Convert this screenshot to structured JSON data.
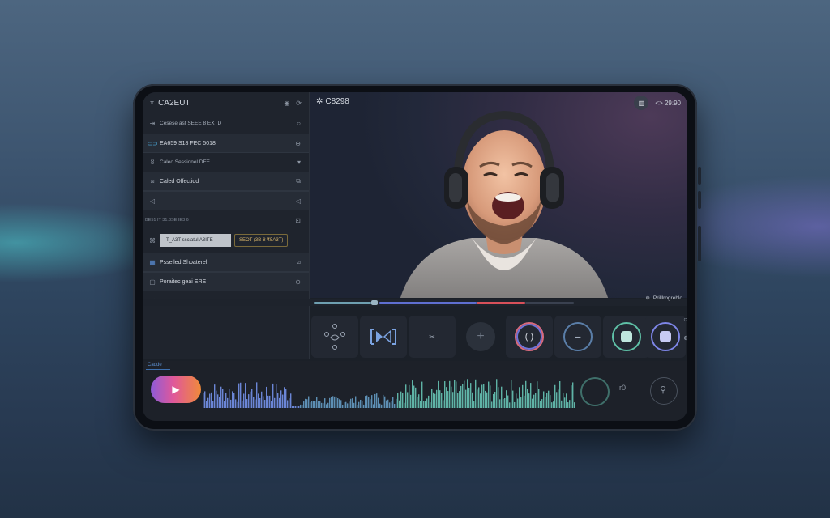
{
  "sidebar": {
    "title": "CA2EUT",
    "items": [
      {
        "label": "Cesese ast SEEE 8 EXTD",
        "type": "plain"
      },
      {
        "label": "EA659 S18 FEC 5018",
        "type": "boxed"
      },
      {
        "label": "Caleo Sessionel DEF",
        "type": "plain"
      },
      {
        "label": "Caled Offectiod",
        "type": "boxed"
      },
      {
        "label": "",
        "type": "boxed"
      },
      {
        "label": "BE51 IT 31.3SE IE3 6",
        "type": "plain"
      },
      {
        "label": "T_A3T ssciatul A3ITE",
        "type": "pill"
      },
      {
        "label": "SEOT (3B-8 ₹5A3T)",
        "type": "pill-gold"
      },
      {
        "label": "Psseiled Shoaterel",
        "type": "boxed"
      },
      {
        "label": "Poraitec geai ERE",
        "type": "boxed"
      },
      {
        "label": "",
        "type": "plain"
      }
    ]
  },
  "video": {
    "title": "C8298",
    "top_right_text": "<> 29:90",
    "progress_label": "Prilllrogreblo"
  },
  "bottom": {
    "tab_label": "Cadde",
    "right_text": "r0"
  },
  "icons": [
    "grid-icon",
    "eye-icon",
    "refresh-icon",
    "video-icon",
    "chevron-down-icon",
    "bike-icon",
    "cube-icon",
    "bookmark-icon",
    "back-icon",
    "send-icon",
    "image-icon",
    "lock-icon",
    "gear-icon",
    "stats-icon",
    "person-icon",
    "play-icon",
    "plus-icon",
    "minus-icon",
    "record-icon",
    "pause-icon",
    "upload-icon"
  ],
  "colors": {
    "accent_purple": "#8d5bd8",
    "accent_pink": "#e0589a",
    "accent_orange": "#f08a3a",
    "ring_red": "#d86a7c",
    "ring_teal": "#5fc1a7",
    "ring_blue": "#7e86e8"
  }
}
